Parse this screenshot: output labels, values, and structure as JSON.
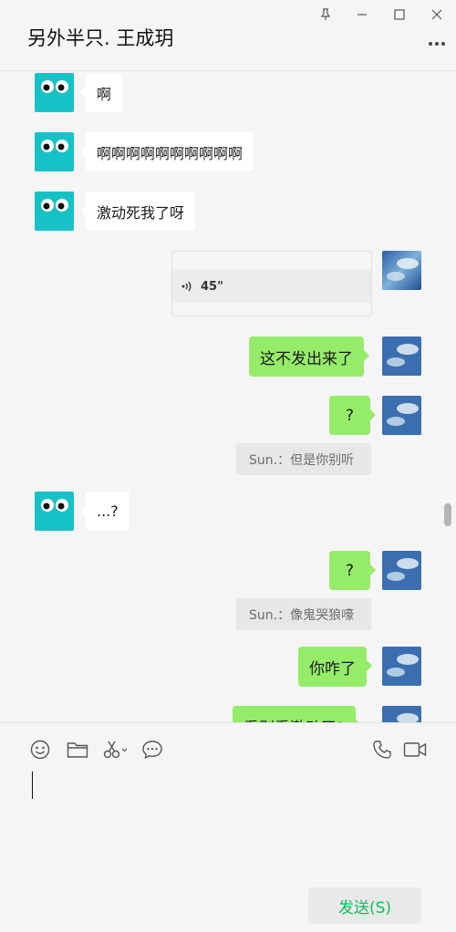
{
  "window": {
    "title": "另外半只. 王成玥",
    "controls": [
      "pin-icon",
      "minimize-icon",
      "maximize-icon",
      "close-icon"
    ],
    "more_icon": "more-dots-icon"
  },
  "messages": [
    {
      "side": "left",
      "text": "啊"
    },
    {
      "side": "left",
      "text": "啊啊啊啊啊啊啊啊啊啊"
    },
    {
      "side": "left",
      "text": "激动死我了呀"
    },
    {
      "side": "right",
      "type": "voice",
      "text": "45\""
    },
    {
      "side": "right",
      "text": "这不发出来了"
    },
    {
      "side": "right",
      "text": "?"
    },
    {
      "type": "quote",
      "text": "Sun.：但是你别听"
    },
    {
      "side": "left",
      "text": "...?"
    },
    {
      "side": "right",
      "text": "?"
    },
    {
      "type": "quote",
      "text": "Sun.：像鬼哭狼嚎"
    },
    {
      "side": "right",
      "text": "你咋了"
    },
    {
      "side": "right",
      "text": "看别看激动了?"
    }
  ],
  "toolbar": {
    "icons": [
      "emoji-icon",
      "folder-icon",
      "scissors-icon",
      "chat-bubble-icon",
      "phone-icon",
      "video-icon"
    ]
  },
  "send_label": "发送(S)",
  "colors": {
    "own_bubble": "#95ec69",
    "other_bubble": "#ffffff",
    "send_text": "#07c160",
    "avatar_left": "#17c2c7"
  }
}
